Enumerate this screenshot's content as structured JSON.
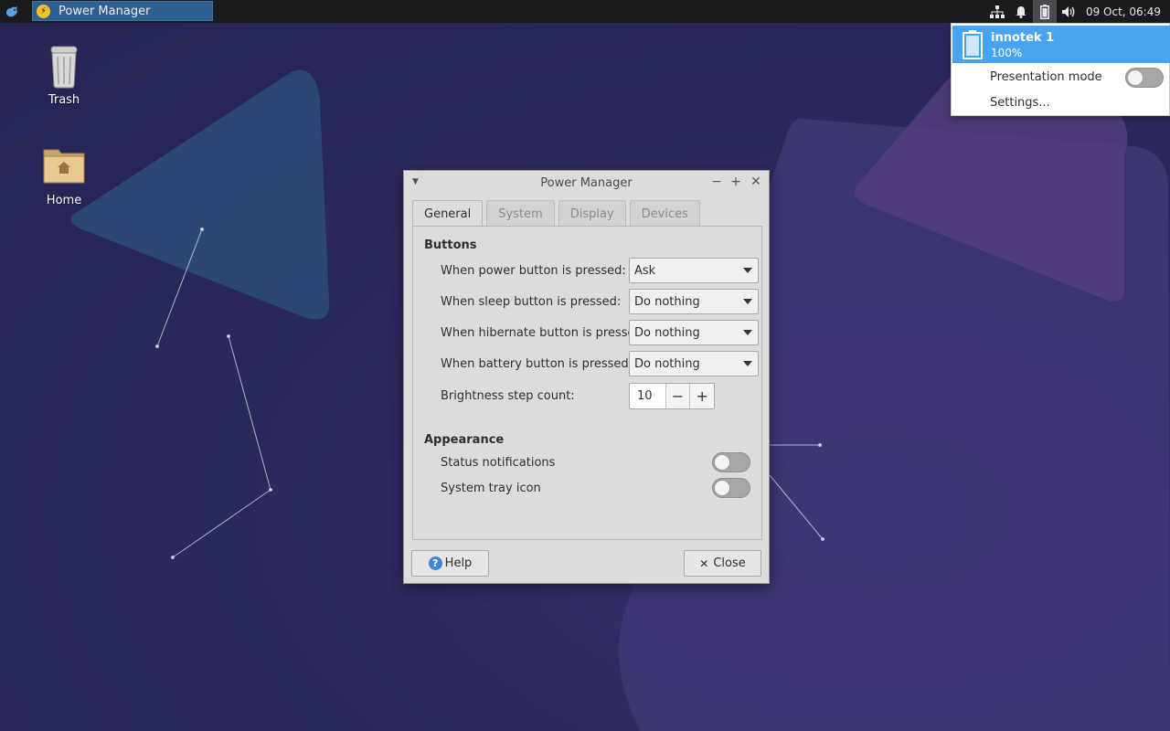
{
  "panel": {
    "task_title": "Power Manager",
    "clock": "09 Oct, 06:49"
  },
  "desktop": {
    "icons": [
      {
        "label": "Trash",
        "icon": "trash-icon"
      },
      {
        "label": "Home",
        "icon": "home-folder-icon"
      }
    ]
  },
  "battery_popup": {
    "device_name": "innotek 1",
    "percent": "100%",
    "presentation_mode_label": "Presentation mode",
    "presentation_mode_on": false,
    "settings_label": "Settings..."
  },
  "dialog": {
    "title": "Power Manager",
    "tabs": [
      {
        "label": "General",
        "active": true
      },
      {
        "label": "System",
        "active": false
      },
      {
        "label": "Display",
        "active": false
      },
      {
        "label": "Devices",
        "active": false
      }
    ],
    "buttons_section": "Buttons",
    "rows": [
      {
        "label": "When power button is pressed:",
        "value": "Ask"
      },
      {
        "label": "When sleep button is pressed:",
        "value": "Do nothing"
      },
      {
        "label": "When hibernate button is pressed:",
        "value": "Do nothing"
      },
      {
        "label": "When battery button is pressed:",
        "value": "Do nothing"
      }
    ],
    "brightness_label": "Brightness step count:",
    "brightness_value": "10",
    "appearance_section": "Appearance",
    "status_notifications_label": "Status notifications",
    "status_notifications_on": false,
    "tray_icon_label": "System tray icon",
    "tray_icon_on": false,
    "help_label": "Help",
    "close_label": "Close"
  },
  "colors": {
    "accent": "#4aa3f0",
    "task_active": "#2e5f92",
    "panel_bg": "#1b1b1e",
    "desktop_bg": "#2c2a5e"
  }
}
